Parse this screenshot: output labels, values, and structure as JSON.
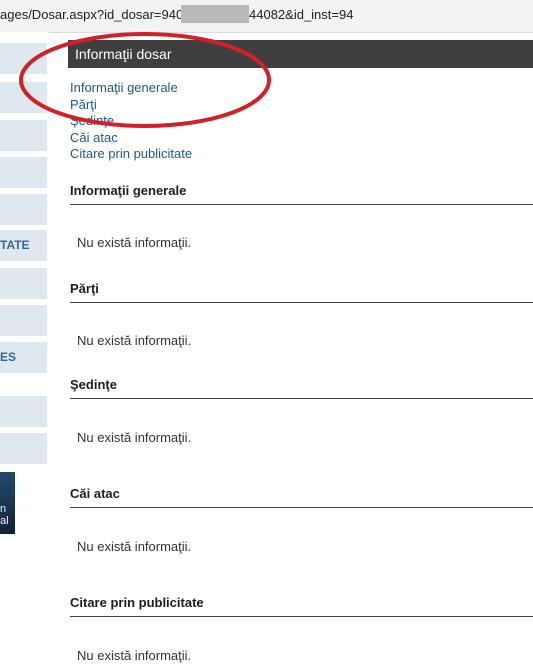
{
  "address_bar": {
    "url_left": "ages/Dosar.aspx?id_dosar=940",
    "url_right": "44082&id_inst=94"
  },
  "sidebar": {
    "items": [
      {
        "label": ""
      },
      {
        "label": ""
      },
      {
        "label": ""
      },
      {
        "label": ""
      },
      {
        "label": ""
      },
      {
        "label": "TATE"
      },
      {
        "label": ""
      },
      {
        "label": ""
      },
      {
        "label": "ES"
      },
      {
        "label": ""
      },
      {
        "label": ""
      }
    ],
    "thumb_text_1": "n",
    "thumb_text_2": "al"
  },
  "header": {
    "title": "Informaţii dosar"
  },
  "nav_links": [
    "Informaţii generale",
    "Părţi",
    "Şedinţe",
    "Căi atac",
    "Citare prin publicitate"
  ],
  "sections": [
    {
      "title": "Informaţii generale",
      "empty_text": "Nu există informaţii."
    },
    {
      "title": "Părţi",
      "empty_text": "Nu există informaţii."
    },
    {
      "title": "Şedinţe",
      "empty_text": "Nu există informaţii."
    },
    {
      "title": "Căi atac",
      "empty_text": "Nu există informaţii."
    },
    {
      "title": "Citare prin publicitate",
      "empty_text": "Nu există informaţii."
    }
  ],
  "colors": {
    "header_bg": "#3f3f3f",
    "link": "#1a5a8e",
    "annotation": "#d22027",
    "sidebar_bg": "#dfe7ef"
  }
}
